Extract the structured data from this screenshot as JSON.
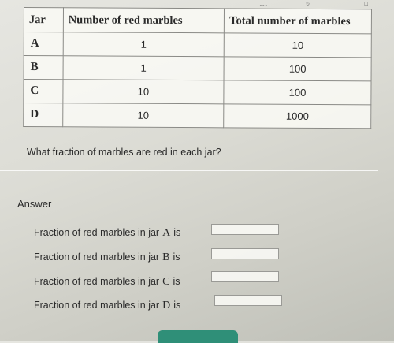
{
  "table": {
    "headers": [
      "Jar",
      "Number of red marbles",
      "Total number of marbles"
    ],
    "rows": [
      {
        "jar": "A",
        "red": "1",
        "total": "10"
      },
      {
        "jar": "B",
        "red": "1",
        "total": "100"
      },
      {
        "jar": "C",
        "red": "10",
        "total": "100"
      },
      {
        "jar": "D",
        "red": "10",
        "total": "1000"
      }
    ]
  },
  "question": "What fraction of marbles are red in each jar?",
  "answer_label": "Answer",
  "answers": [
    {
      "prefix": "Fraction of red marbles in jar",
      "jar": "A",
      "suffix": "is",
      "value": ""
    },
    {
      "prefix": "Fraction of red marbles in jar",
      "jar": "B",
      "suffix": "is",
      "value": ""
    },
    {
      "prefix": "Fraction of red marbles in jar",
      "jar": "C",
      "suffix": "is",
      "value": ""
    },
    {
      "prefix": "Fraction of red marbles in jar",
      "jar": "D",
      "suffix": "is",
      "value": ""
    }
  ],
  "colors": {
    "button": "#2f8f78"
  }
}
